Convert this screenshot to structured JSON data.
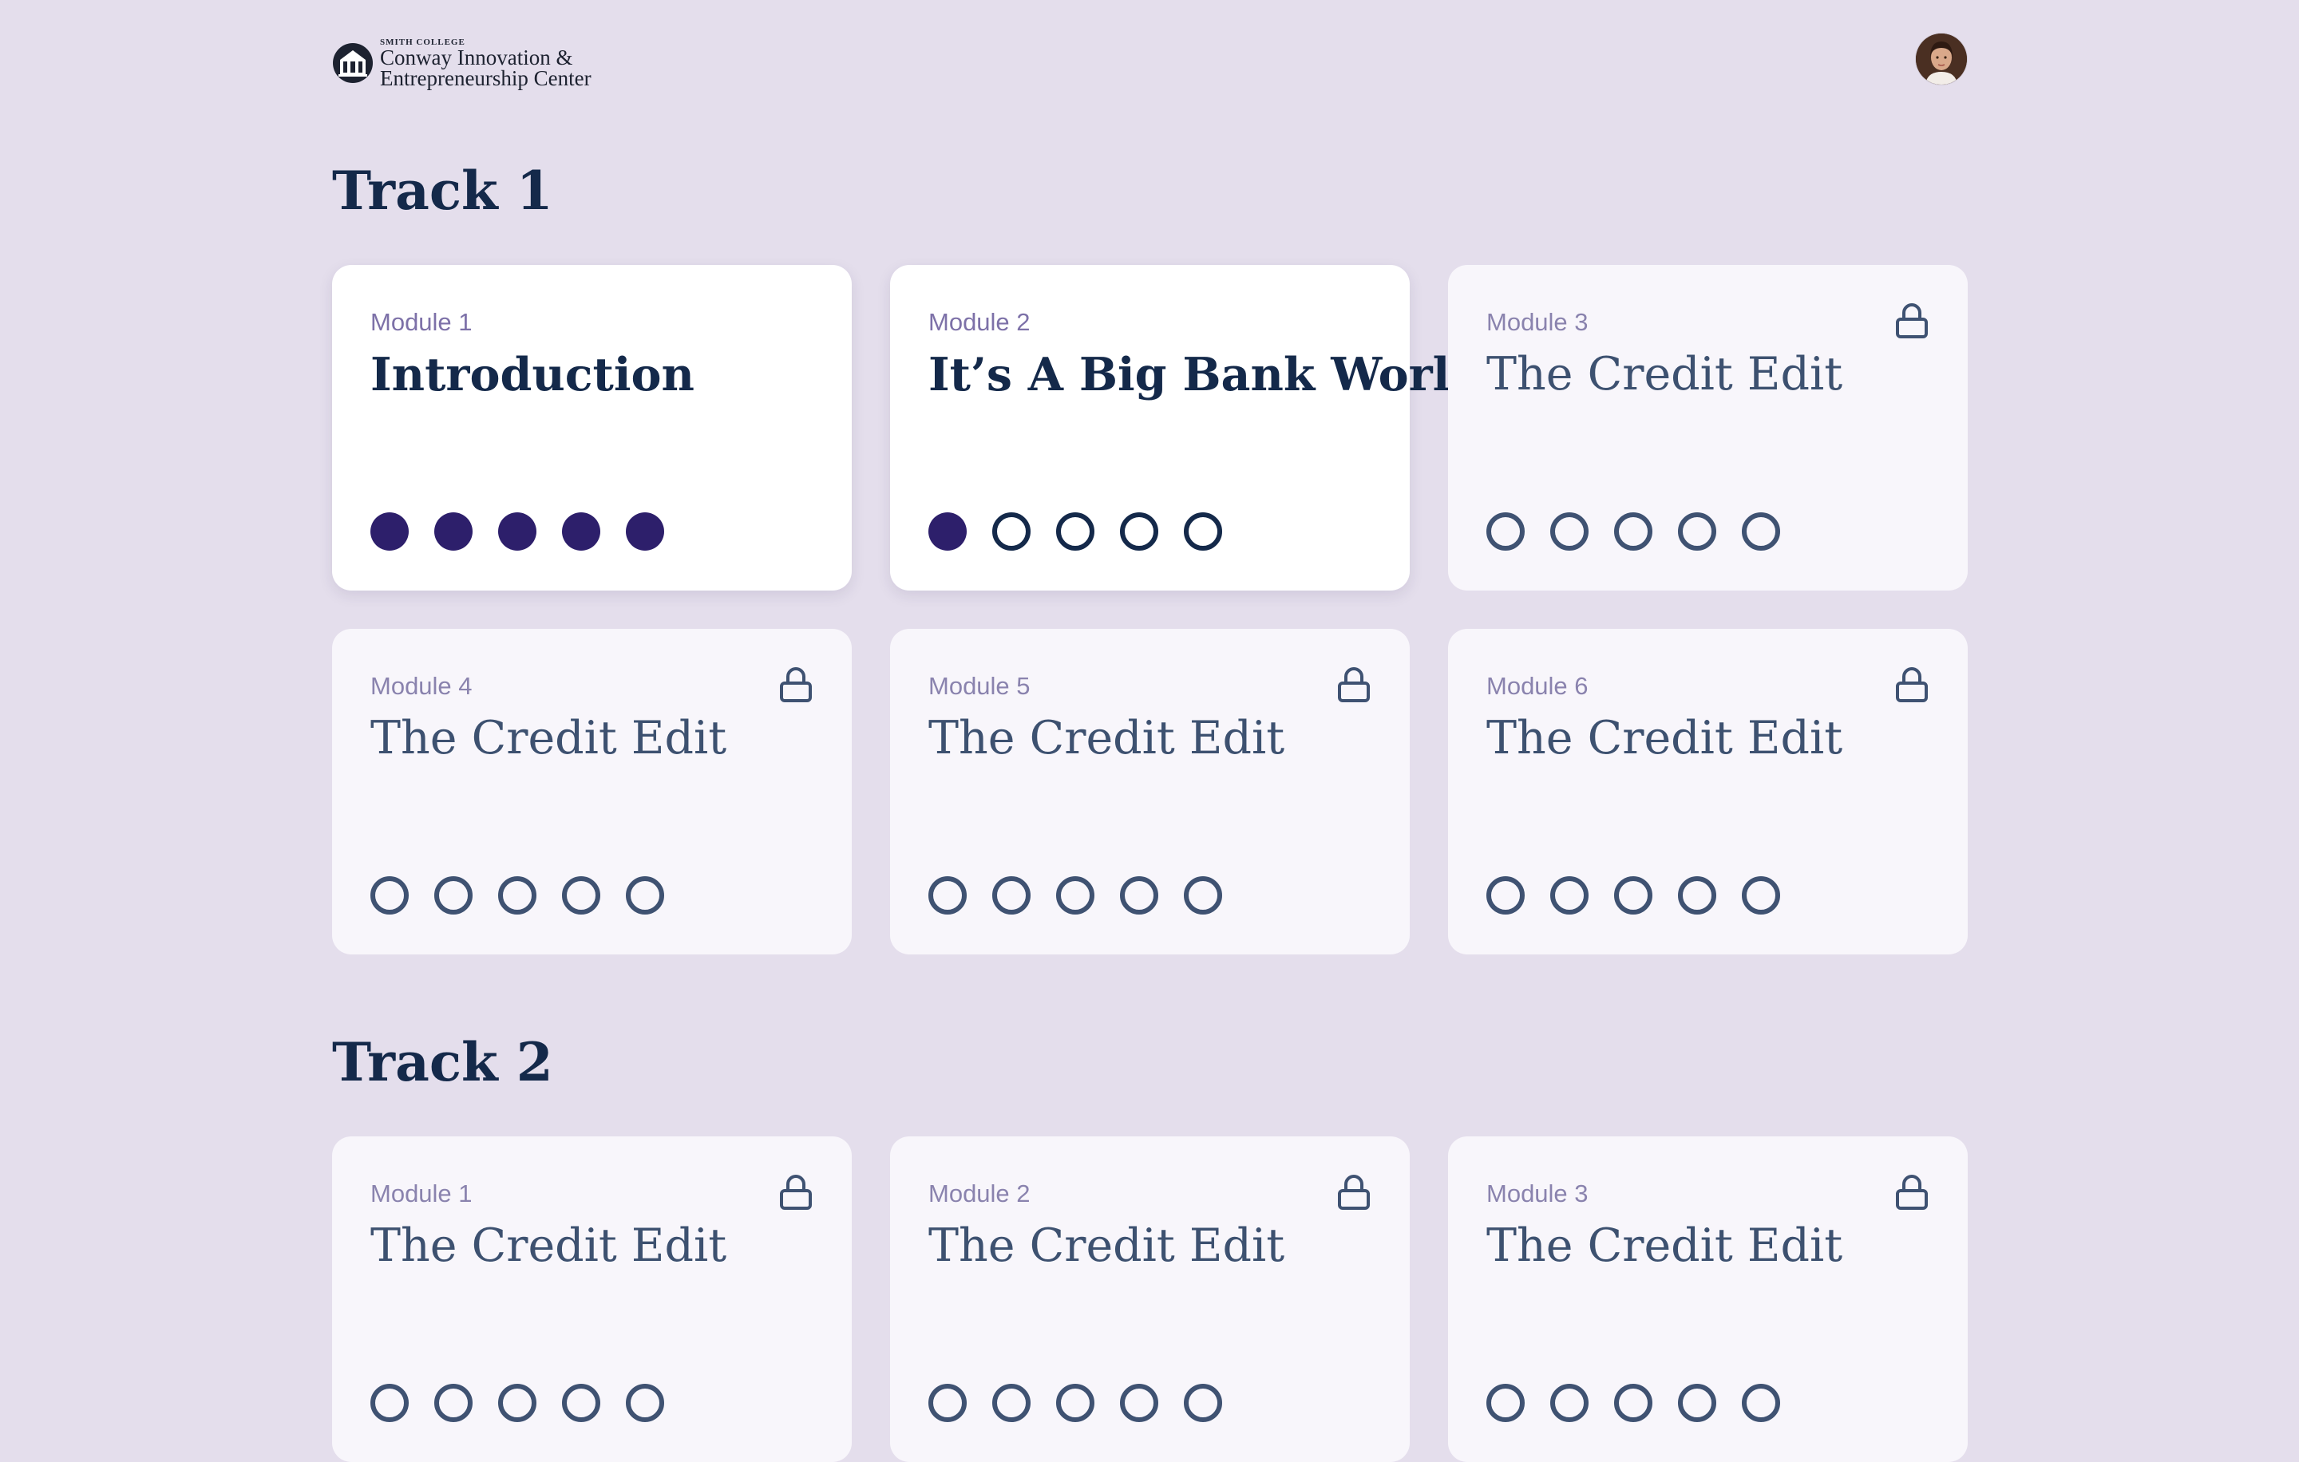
{
  "header": {
    "logo_small": "SMITH COLLEGE",
    "logo_line1": "Conway Innovation &",
    "logo_line2": "Entrepreneurship Center"
  },
  "tracks": [
    {
      "title": "Track 1",
      "modules": [
        {
          "label": "Module 1",
          "title": "Introduction",
          "locked": false,
          "progress": [
            1,
            1,
            1,
            1,
            1
          ]
        },
        {
          "label": "Module 2",
          "title": "It’s A Big Bank World",
          "locked": false,
          "progress": [
            1,
            0,
            0,
            0,
            0
          ]
        },
        {
          "label": "Module 3",
          "title": "The Credit Edit",
          "locked": true,
          "progress": [
            0,
            0,
            0,
            0,
            0
          ]
        },
        {
          "label": "Module 4",
          "title": "The Credit Edit",
          "locked": true,
          "progress": [
            0,
            0,
            0,
            0,
            0
          ]
        },
        {
          "label": "Module 5",
          "title": "The Credit Edit",
          "locked": true,
          "progress": [
            0,
            0,
            0,
            0,
            0
          ]
        },
        {
          "label": "Module 6",
          "title": "The Credit Edit",
          "locked": true,
          "progress": [
            0,
            0,
            0,
            0,
            0
          ]
        }
      ]
    },
    {
      "title": "Track 2",
      "modules": [
        {
          "label": "Module 1",
          "title": "The Credit Edit",
          "locked": true,
          "progress": [
            0,
            0,
            0,
            0,
            0
          ]
        },
        {
          "label": "Module 2",
          "title": "The Credit Edit",
          "locked": true,
          "progress": [
            0,
            0,
            0,
            0,
            0
          ]
        },
        {
          "label": "Module 3",
          "title": "The Credit Edit",
          "locked": true,
          "progress": [
            0,
            0,
            0,
            0,
            0
          ]
        }
      ]
    }
  ],
  "icons": {
    "lock": "lock-icon",
    "avatar": "user-avatar"
  },
  "colors": {
    "background": "#e4deec",
    "accent": "#2d1f6b",
    "heading": "#14294a"
  }
}
